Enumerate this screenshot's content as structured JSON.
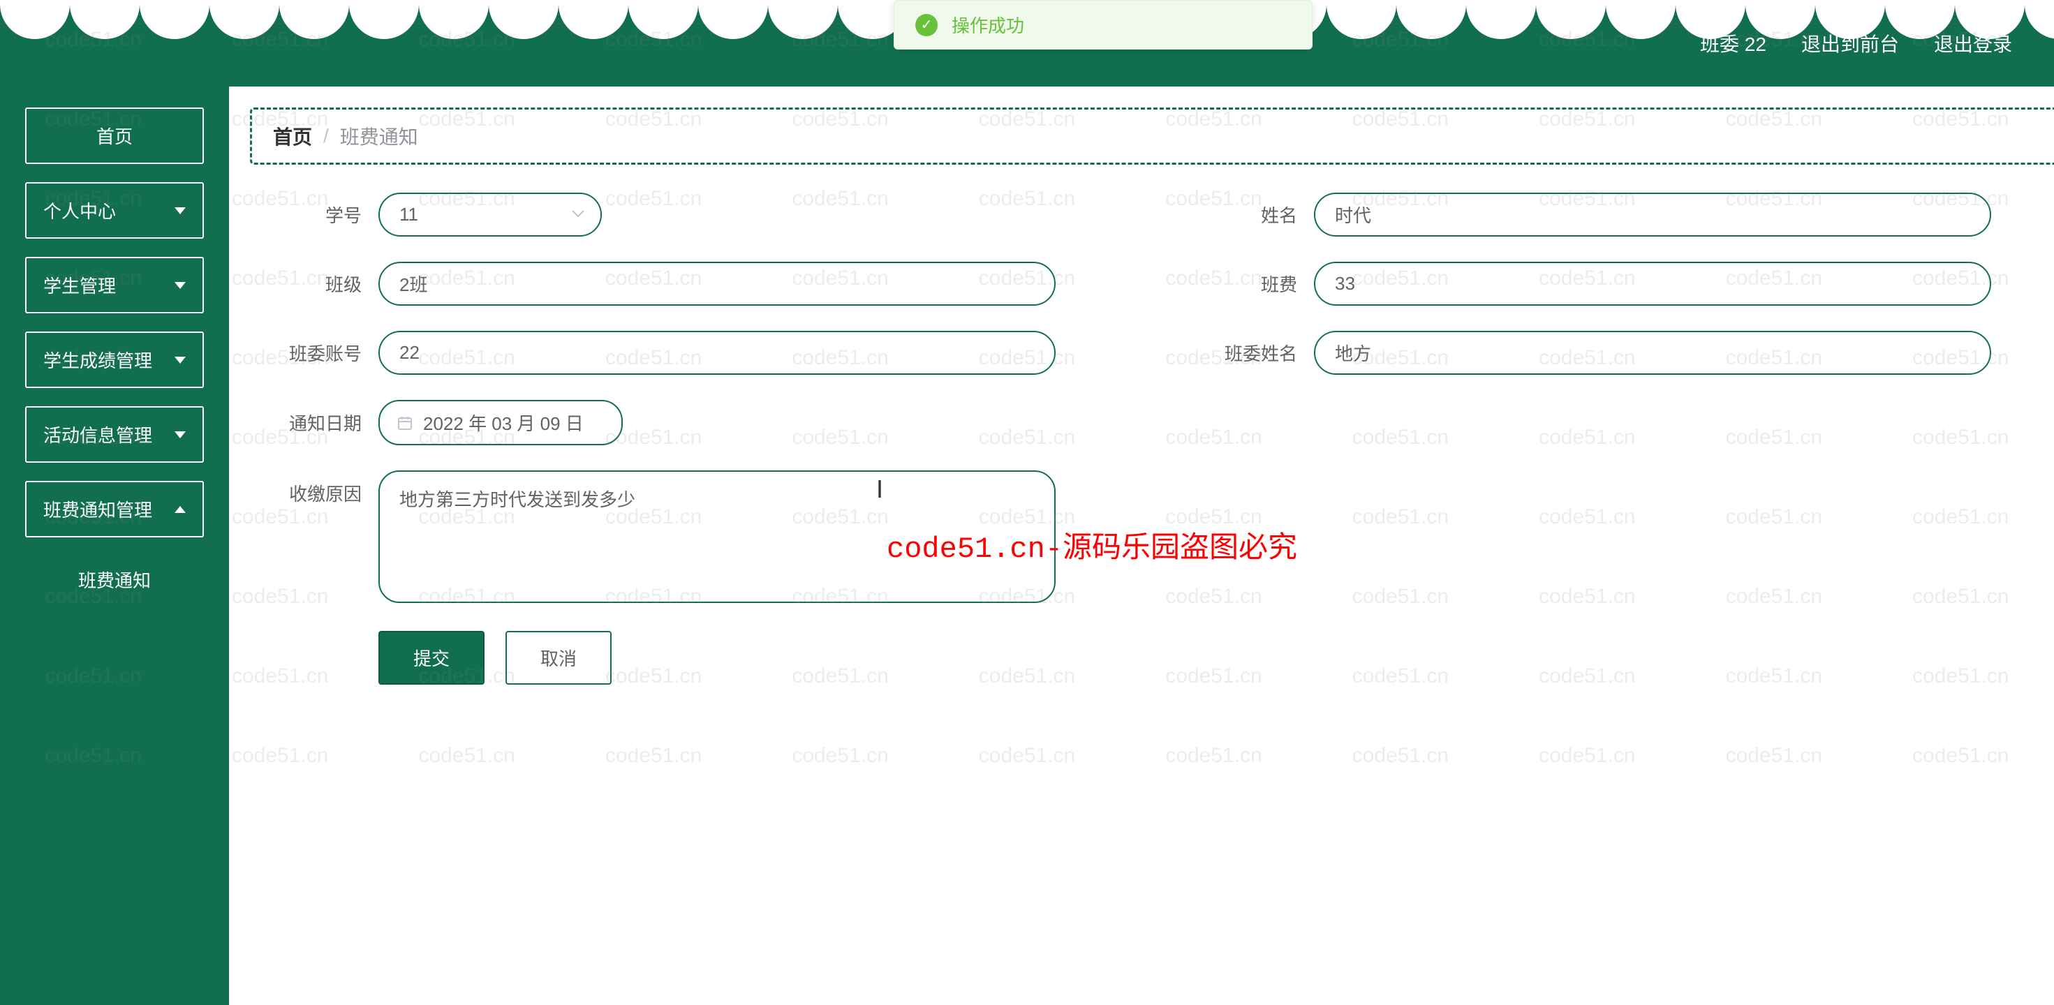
{
  "header": {
    "user_label": "班委 22",
    "logout_front": "退出到前台",
    "logout": "退出登录"
  },
  "toast": {
    "message": "操作成功"
  },
  "sidebar": {
    "items": [
      {
        "label": "首页",
        "has_caret": false
      },
      {
        "label": "个人中心",
        "has_caret": true
      },
      {
        "label": "学生管理",
        "has_caret": true
      },
      {
        "label": "学生成绩管理",
        "has_caret": true
      },
      {
        "label": "活动信息管理",
        "has_caret": true
      },
      {
        "label": "班费通知管理",
        "has_caret": true,
        "expanded": true
      }
    ],
    "subitem": "班费通知"
  },
  "breadcrumb": {
    "home": "首页",
    "current": "班费通知"
  },
  "form": {
    "student_id": {
      "label": "学号",
      "value": "11"
    },
    "name": {
      "label": "姓名",
      "value": "时代"
    },
    "class": {
      "label": "班级",
      "value": "2班"
    },
    "fee": {
      "label": "班费",
      "value": "33"
    },
    "committee_account": {
      "label": "班委账号",
      "value": "22"
    },
    "committee_name": {
      "label": "班委姓名",
      "value": "地方"
    },
    "notice_date": {
      "label": "通知日期",
      "value": "2022 年 03 月 09 日"
    },
    "reason": {
      "label": "收缴原因",
      "value": "地方第三方时代发送到发多少"
    },
    "submit": "提交",
    "cancel": "取消"
  },
  "watermark": {
    "text": "code51.cn",
    "center": "code51.cn-源码乐园盗图必究"
  }
}
